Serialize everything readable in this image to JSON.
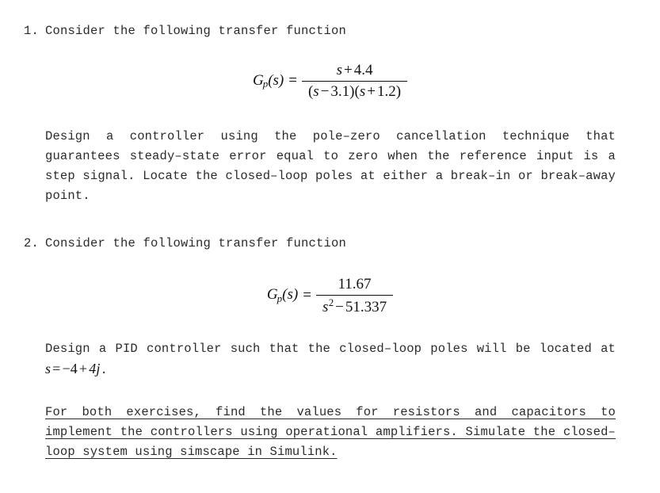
{
  "document": {
    "page_background": "#ffffff",
    "text_color": "#2b2b2b",
    "math_color": "#111111"
  },
  "items": [
    {
      "number": "1.",
      "title": "Consider the following transfer function",
      "equation": {
        "lhs_main": "G",
        "lhs_sub": "p",
        "lhs_arg": "(s)",
        "equals": "=",
        "numerator": "s + 4.4",
        "denominator": "(s − 3.1)(s + 1.2)",
        "numerator_parts": {
          "var": "s",
          "op": "+",
          "value": "4.4"
        },
        "denominator_parts": {
          "factor1": {
            "var": "s",
            "op": "−",
            "value": "3.1"
          },
          "factor2": {
            "var": "s",
            "op": "+",
            "value": "1.2"
          }
        }
      },
      "body": "Design a controller using the pole–zero cancellation technique that guarantees steady–state error equal to zero when the reference input is a step signal. Locate the closed–loop poles at either a break–in or break–away point."
    },
    {
      "number": "2.",
      "title": "Consider the following transfer function",
      "equation": {
        "lhs_main": "G",
        "lhs_sub": "p",
        "lhs_arg": "(s)",
        "equals": "=",
        "numerator": "11.67",
        "denominator": "s² − 51.337",
        "denominator_parts": {
          "var": "s",
          "exponent": "2",
          "op": "−",
          "value": "51.337"
        }
      },
      "body_before_math": "Design a PID controller such that the closed–loop poles will be located at ",
      "inline_math": {
        "var": "s",
        "equals": "=",
        "expr_real": "−4",
        "op": "+",
        "expr_imag": "4j"
      },
      "body_after_math": "."
    }
  ],
  "closing_note": {
    "text": "For both exercises, find the values for resistors and capacitors to implement the controllers using operational amplifiers. Simulate the closed–loop system using simscape in Simulink.",
    "underlined": true
  }
}
